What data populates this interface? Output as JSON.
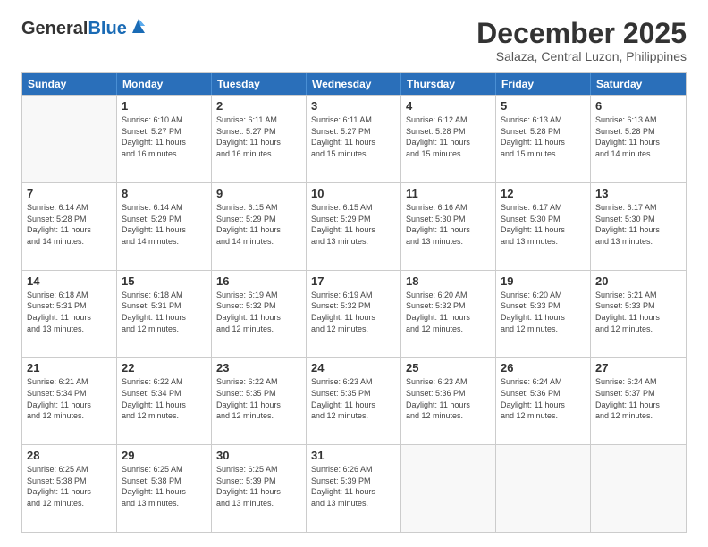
{
  "header": {
    "logo_general": "General",
    "logo_blue": "Blue",
    "main_title": "December 2025",
    "subtitle": "Salaza, Central Luzon, Philippines"
  },
  "weekdays": [
    "Sunday",
    "Monday",
    "Tuesday",
    "Wednesday",
    "Thursday",
    "Friday",
    "Saturday"
  ],
  "weeks": [
    [
      {
        "day": "",
        "info": ""
      },
      {
        "day": "1",
        "info": "Sunrise: 6:10 AM\nSunset: 5:27 PM\nDaylight: 11 hours\nand 16 minutes."
      },
      {
        "day": "2",
        "info": "Sunrise: 6:11 AM\nSunset: 5:27 PM\nDaylight: 11 hours\nand 16 minutes."
      },
      {
        "day": "3",
        "info": "Sunrise: 6:11 AM\nSunset: 5:27 PM\nDaylight: 11 hours\nand 15 minutes."
      },
      {
        "day": "4",
        "info": "Sunrise: 6:12 AM\nSunset: 5:28 PM\nDaylight: 11 hours\nand 15 minutes."
      },
      {
        "day": "5",
        "info": "Sunrise: 6:13 AM\nSunset: 5:28 PM\nDaylight: 11 hours\nand 15 minutes."
      },
      {
        "day": "6",
        "info": "Sunrise: 6:13 AM\nSunset: 5:28 PM\nDaylight: 11 hours\nand 14 minutes."
      }
    ],
    [
      {
        "day": "7",
        "info": "Sunrise: 6:14 AM\nSunset: 5:28 PM\nDaylight: 11 hours\nand 14 minutes."
      },
      {
        "day": "8",
        "info": "Sunrise: 6:14 AM\nSunset: 5:29 PM\nDaylight: 11 hours\nand 14 minutes."
      },
      {
        "day": "9",
        "info": "Sunrise: 6:15 AM\nSunset: 5:29 PM\nDaylight: 11 hours\nand 14 minutes."
      },
      {
        "day": "10",
        "info": "Sunrise: 6:15 AM\nSunset: 5:29 PM\nDaylight: 11 hours\nand 13 minutes."
      },
      {
        "day": "11",
        "info": "Sunrise: 6:16 AM\nSunset: 5:30 PM\nDaylight: 11 hours\nand 13 minutes."
      },
      {
        "day": "12",
        "info": "Sunrise: 6:17 AM\nSunset: 5:30 PM\nDaylight: 11 hours\nand 13 minutes."
      },
      {
        "day": "13",
        "info": "Sunrise: 6:17 AM\nSunset: 5:30 PM\nDaylight: 11 hours\nand 13 minutes."
      }
    ],
    [
      {
        "day": "14",
        "info": "Sunrise: 6:18 AM\nSunset: 5:31 PM\nDaylight: 11 hours\nand 13 minutes."
      },
      {
        "day": "15",
        "info": "Sunrise: 6:18 AM\nSunset: 5:31 PM\nDaylight: 11 hours\nand 12 minutes."
      },
      {
        "day": "16",
        "info": "Sunrise: 6:19 AM\nSunset: 5:32 PM\nDaylight: 11 hours\nand 12 minutes."
      },
      {
        "day": "17",
        "info": "Sunrise: 6:19 AM\nSunset: 5:32 PM\nDaylight: 11 hours\nand 12 minutes."
      },
      {
        "day": "18",
        "info": "Sunrise: 6:20 AM\nSunset: 5:32 PM\nDaylight: 11 hours\nand 12 minutes."
      },
      {
        "day": "19",
        "info": "Sunrise: 6:20 AM\nSunset: 5:33 PM\nDaylight: 11 hours\nand 12 minutes."
      },
      {
        "day": "20",
        "info": "Sunrise: 6:21 AM\nSunset: 5:33 PM\nDaylight: 11 hours\nand 12 minutes."
      }
    ],
    [
      {
        "day": "21",
        "info": "Sunrise: 6:21 AM\nSunset: 5:34 PM\nDaylight: 11 hours\nand 12 minutes."
      },
      {
        "day": "22",
        "info": "Sunrise: 6:22 AM\nSunset: 5:34 PM\nDaylight: 11 hours\nand 12 minutes."
      },
      {
        "day": "23",
        "info": "Sunrise: 6:22 AM\nSunset: 5:35 PM\nDaylight: 11 hours\nand 12 minutes."
      },
      {
        "day": "24",
        "info": "Sunrise: 6:23 AM\nSunset: 5:35 PM\nDaylight: 11 hours\nand 12 minutes."
      },
      {
        "day": "25",
        "info": "Sunrise: 6:23 AM\nSunset: 5:36 PM\nDaylight: 11 hours\nand 12 minutes."
      },
      {
        "day": "26",
        "info": "Sunrise: 6:24 AM\nSunset: 5:36 PM\nDaylight: 11 hours\nand 12 minutes."
      },
      {
        "day": "27",
        "info": "Sunrise: 6:24 AM\nSunset: 5:37 PM\nDaylight: 11 hours\nand 12 minutes."
      }
    ],
    [
      {
        "day": "28",
        "info": "Sunrise: 6:25 AM\nSunset: 5:38 PM\nDaylight: 11 hours\nand 12 minutes."
      },
      {
        "day": "29",
        "info": "Sunrise: 6:25 AM\nSunset: 5:38 PM\nDaylight: 11 hours\nand 13 minutes."
      },
      {
        "day": "30",
        "info": "Sunrise: 6:25 AM\nSunset: 5:39 PM\nDaylight: 11 hours\nand 13 minutes."
      },
      {
        "day": "31",
        "info": "Sunrise: 6:26 AM\nSunset: 5:39 PM\nDaylight: 11 hours\nand 13 minutes."
      },
      {
        "day": "",
        "info": ""
      },
      {
        "day": "",
        "info": ""
      },
      {
        "day": "",
        "info": ""
      }
    ]
  ]
}
